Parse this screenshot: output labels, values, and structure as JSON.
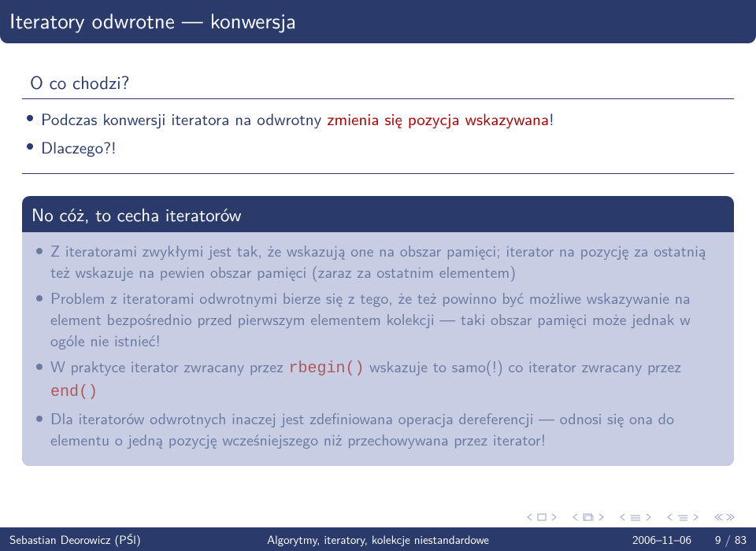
{
  "title": "Iteratory odwrotne — konwersja",
  "block1": {
    "title": "O co chodzi?",
    "items": [
      {
        "pre": "Podczas konwersji iteratora na odwrotny ",
        "red": "zmienia się pozycja wskazywana",
        "post": "!"
      },
      {
        "pre": "Dlaczego?!",
        "red": "",
        "post": ""
      }
    ]
  },
  "block2": {
    "title": "No cóż, to cecha iteratorów",
    "items": [
      "Z iteratorami zwykłymi jest tak, że wskazują one na obszar pamięci; iterator na pozycję za ostatnią też wskazuje na pewien obszar pamięci (zaraz za ostatnim elementem)",
      "Problem z iteratorami odwrotnymi bierze się z tego, że też powinno być możliwe wskazywanie na element bezpośrednio przed pierwszym elementem kolekcji — taki obszar pamięci może jednak w ogóle nie istnieć!",
      {
        "a": "W praktyce iterator zwracany przez ",
        "c1": "rbegin()",
        "b": " wskazuje to samo(!) co iterator zwracany przez ",
        "c2": "end()"
      },
      "Dla iteratorów odwrotnych inaczej jest zdefiniowana operacja dereferencji — odnosi się ona do elementu o jedną pozycję wcześniejszego niż przechowywana przez iterator!"
    ]
  },
  "footer": {
    "left": "Sebastian Deorowicz (PŚl)",
    "center": "Algorytmy, iteratory, kolekcje niestandardowe",
    "date": "2006–11–06",
    "page": "9 / 83"
  }
}
